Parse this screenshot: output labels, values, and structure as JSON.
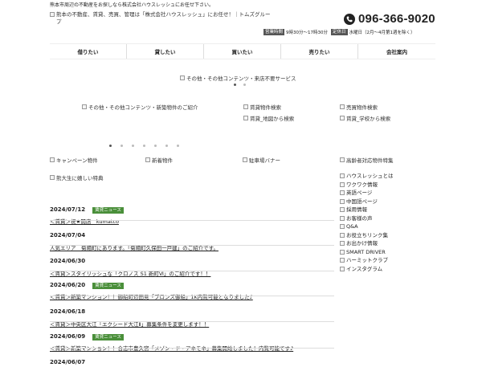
{
  "header": {
    "tagline": "熊本市周辺の不動産をお探しなら株式会社ハウスレッシュにお任せ下さい。",
    "logo_alt": "熊本の不動産、賃貸、売買、管理は「株式会社ハウスレッシュ」にお任せ！｜トムズグループ",
    "phone": "096-366-9020",
    "hours_label": "営業時間",
    "hours": "9時30分～17時30分",
    "holiday_label": "定休日",
    "holiday": "水曜日（2月～4月第1週を除く）"
  },
  "nav": [
    "借りたい",
    "貸したい",
    "買いたい",
    "売りたい",
    "会社案内"
  ],
  "banners": {
    "main_slider": "その他・その他コンテンツ・来店不要サービス",
    "new_property": "その他・その他コンテンツ・新築物件のご紹介",
    "rent_search": "賃貸物件検索",
    "sale_search": "売買物件検索",
    "rent_map": "賃貸_地図から検索",
    "rent_school": "賃貸_学校から検索",
    "campaign": "キャンペーン物件",
    "new_arrival": "新着物件",
    "parking": "駐車場バナー",
    "elderly": "高齢者対応物件特集",
    "student": "熊大生に嬉しい特典"
  },
  "news": [
    {
      "date": "2024/07/12",
      "badge": "賃貸ニュース",
      "text": "＜賃貸＞祝★開店　kumatco"
    },
    {
      "date": "2024/07/04",
      "badge": "",
      "text": "人気エリア　菊陽町にあります。「菊陽町久保田一戸建」のご紹介です。"
    },
    {
      "date": "2024/06/30",
      "badge": "",
      "text": "＜賃貸＞スタイリッシュな「クロノス S1 新町Ⅵ」のご紹介です！！"
    },
    {
      "date": "2024/06/20",
      "badge": "賃貸ニュース",
      "text": "＜賃貸＞新築マンション！！御船町辺田見「ブロンズ御船」1K内覧可能となりました♪"
    },
    {
      "date": "2024/06/18",
      "badge": "",
      "text": "＜賃貸＞中央区大江「エクシード大江Ⅱ」募集条件を変更します！！"
    },
    {
      "date": "2024/06/09",
      "badge": "賃貸ニュース",
      "text": "＜賃貸＞新築マンション！！合志市豊久宮「メゾン・ド・アネモネ」募集開始しました！内覧可能です♪"
    },
    {
      "date": "2024/06/07",
      "badge": "",
      "text": ""
    }
  ],
  "sidebar": [
    "ハウスレッシュとは",
    "ワクワク情報",
    "英語ページ",
    "中国語ページ",
    "採用情報",
    "お客様の声",
    "Q&A",
    "お役立ちリンク集",
    "お出かけ情報",
    "SMART DRIVER",
    "ハーミットクラブ",
    "インスタグラム"
  ],
  "colors": {
    "badge_green": "#4a8f3a",
    "label_gray": "#555555"
  }
}
